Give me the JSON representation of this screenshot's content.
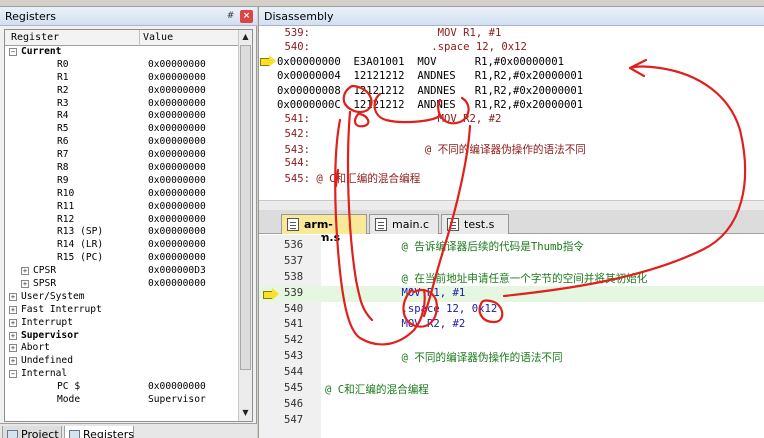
{
  "registers": {
    "title": "Registers",
    "pin_glyph": "#",
    "close_glyph": "×",
    "col_register": "Register",
    "col_value": "Value",
    "rows": [
      {
        "name": "Current",
        "value": "",
        "indent": 0,
        "toggle": "−",
        "bold": true
      },
      {
        "name": "R0",
        "value": "0x00000000",
        "indent": 2
      },
      {
        "name": "R1",
        "value": "0x00000000",
        "indent": 2
      },
      {
        "name": "R2",
        "value": "0x00000000",
        "indent": 2
      },
      {
        "name": "R3",
        "value": "0x00000000",
        "indent": 2
      },
      {
        "name": "R4",
        "value": "0x00000000",
        "indent": 2
      },
      {
        "name": "R5",
        "value": "0x00000000",
        "indent": 2
      },
      {
        "name": "R6",
        "value": "0x00000000",
        "indent": 2
      },
      {
        "name": "R7",
        "value": "0x00000000",
        "indent": 2
      },
      {
        "name": "R8",
        "value": "0x00000000",
        "indent": 2
      },
      {
        "name": "R9",
        "value": "0x00000000",
        "indent": 2
      },
      {
        "name": "R10",
        "value": "0x00000000",
        "indent": 2
      },
      {
        "name": "R11",
        "value": "0x00000000",
        "indent": 2
      },
      {
        "name": "R12",
        "value": "0x00000000",
        "indent": 2
      },
      {
        "name": "R13 (SP)",
        "value": "0x00000000",
        "indent": 2
      },
      {
        "name": "R14 (LR)",
        "value": "0x00000000",
        "indent": 2
      },
      {
        "name": "R15 (PC)",
        "value": "0x00000000",
        "indent": 2
      },
      {
        "name": "CPSR",
        "value": "0x000000D3",
        "indent": 1,
        "toggle": "+"
      },
      {
        "name": "SPSR",
        "value": "0x00000000",
        "indent": 1,
        "toggle": "+"
      },
      {
        "name": "User/System",
        "value": "",
        "indent": 0,
        "toggle": "+"
      },
      {
        "name": "Fast Interrupt",
        "value": "",
        "indent": 0,
        "toggle": "+"
      },
      {
        "name": "Interrupt",
        "value": "",
        "indent": 0,
        "toggle": "+"
      },
      {
        "name": "Supervisor",
        "value": "",
        "indent": 0,
        "toggle": "+",
        "bold": true
      },
      {
        "name": "Abort",
        "value": "",
        "indent": 0,
        "toggle": "+"
      },
      {
        "name": "Undefined",
        "value": "",
        "indent": 0,
        "toggle": "+"
      },
      {
        "name": "Internal",
        "value": "",
        "indent": 0,
        "toggle": "−"
      },
      {
        "name": "PC  $",
        "value": "0x00000000",
        "indent": 2
      },
      {
        "name": "Mode",
        "value": "Supervisor",
        "indent": 2
      }
    ],
    "scroll_up": "▲",
    "scroll_down": "▼"
  },
  "bottom_tabs": {
    "project": "Project",
    "registers": "Registers"
  },
  "disassembly": {
    "title": "Disassembly",
    "lines": [
      {
        "text": "    539:                    MOV R1, #1",
        "type": "src"
      },
      {
        "text": "    540:                   .space 12, 0x12",
        "type": "src"
      },
      {
        "text": "0x00000000  E3A01001  MOV      R1,#0x00000001",
        "type": "asm",
        "current": true
      },
      {
        "text": "0x00000004  12121212  ANDNES   R1,R2,#0x20000001",
        "type": "asm"
      },
      {
        "text": "0x00000008  12121212  ANDNES   R1,R2,#0x20000001",
        "type": "asm"
      },
      {
        "text": "0x0000000C  12121212  ANDNES   R1,R2,#0x20000001",
        "type": "asm"
      },
      {
        "text": "    541:                    MOV R2, #2",
        "type": "src"
      },
      {
        "text": "    542:",
        "type": "src"
      },
      {
        "text": "    543:                  @ 不同的编译器伪操作的语法不同",
        "type": "src"
      },
      {
        "text": "    544:",
        "type": "src"
      },
      {
        "text": "    545: @ C和汇编的混合编程",
        "type": "src"
      }
    ]
  },
  "editor": {
    "tabs": [
      "arm-asm.s",
      "main.c",
      "test.s"
    ],
    "lines": [
      {
        "num": "536",
        "code": "            @ 告诉编译器后续的代码是Thumb指令"
      },
      {
        "num": "537",
        "code": ""
      },
      {
        "num": "538",
        "code": "            @ 在当前地址申请任意一个字节的空间并将其初始化"
      },
      {
        "num": "539",
        "code": "            MOV R1, #1",
        "current": true
      },
      {
        "num": "540",
        "code": "            .space 12, 0x12"
      },
      {
        "num": "541",
        "code": "            MOV R2, #2"
      },
      {
        "num": "542",
        "code": ""
      },
      {
        "num": "543",
        "code": "            @ 不同的编译器伪操作的语法不同"
      },
      {
        "num": "544",
        "code": ""
      },
      {
        "num": "545",
        "code": "@ C和汇编的混合编程"
      },
      {
        "num": "546",
        "code": ""
      },
      {
        "num": "547",
        "code": ""
      }
    ]
  },
  "colors": {
    "annotation": "#e0201c",
    "source_line": "#8b1a1a",
    "comment": "#1a7a1a",
    "keyword": "#1a1aa8",
    "current_line_bg": "#e6f7e1",
    "exec_arrow": "#f7e12a"
  }
}
